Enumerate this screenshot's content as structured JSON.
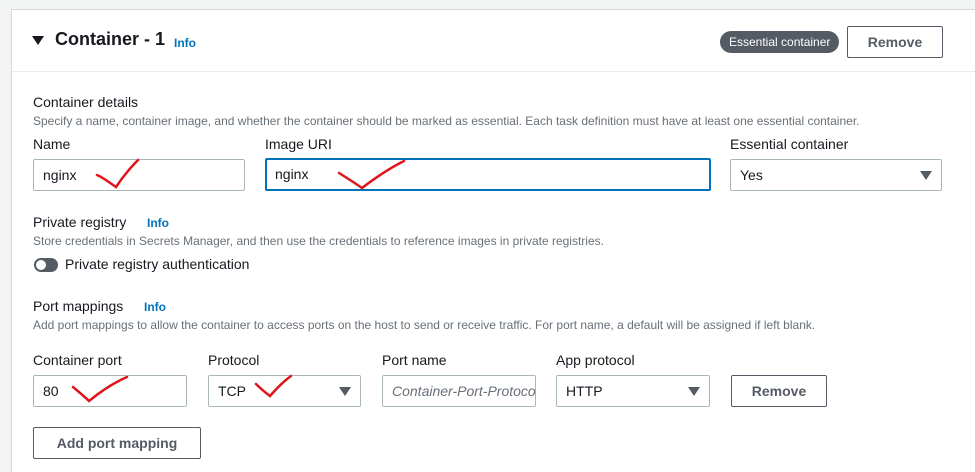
{
  "container": {
    "title": "Container - 1",
    "info": "Info",
    "badge": "Essential container",
    "remove": "Remove"
  },
  "details": {
    "heading": "Container details",
    "description": "Specify a name, container image, and whether the container should be marked as essential. Each task definition must have at least one essential container.",
    "name_label": "Name",
    "name_value": "nginx",
    "image_label": "Image URI",
    "image_value": "nginx",
    "essential_label": "Essential container",
    "essential_value": "Yes"
  },
  "registry": {
    "heading": "Private registry",
    "info": "Info",
    "description": "Store credentials in Secrets Manager, and then use the credentials to reference images in private registries.",
    "toggle_label": "Private registry authentication"
  },
  "ports": {
    "heading": "Port mappings",
    "info": "Info",
    "description": "Add port mappings to allow the container to access ports on the host to send or receive traffic. For port name, a default will be assigned if left blank.",
    "container_port_label": "Container port",
    "container_port_value": "80",
    "protocol_label": "Protocol",
    "protocol_value": "TCP",
    "port_name_label": "Port name",
    "port_name_placeholder": "Container-Port-Protocol",
    "app_protocol_label": "App protocol",
    "app_protocol_value": "HTTP",
    "remove": "Remove",
    "add": "Add port mapping"
  },
  "colors": {
    "annotation": "#e0141b",
    "link": "#0073bb",
    "focus": "#0073bb"
  }
}
